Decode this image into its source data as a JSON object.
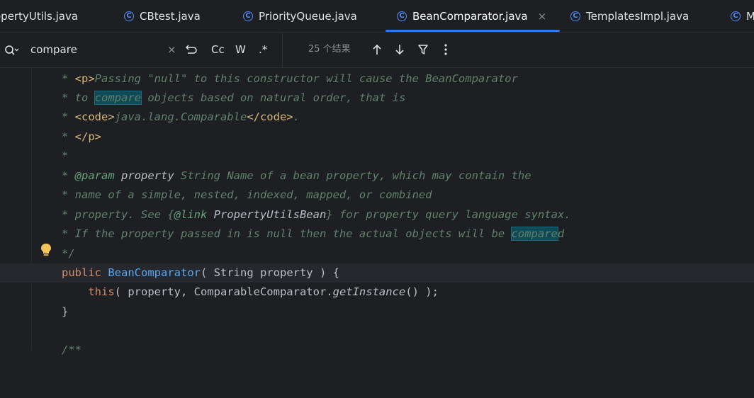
{
  "tabs": [
    {
      "label": "opertyUtils.java",
      "active": false,
      "icon": "class-icon"
    },
    {
      "label": "CBtest.java",
      "active": false,
      "icon": "class-icon"
    },
    {
      "label": "PriorityQueue.java",
      "active": false,
      "icon": "class-icon"
    },
    {
      "label": "BeanComparator.java",
      "active": true,
      "icon": "class-icon"
    },
    {
      "label": "TemplatesImpl.java",
      "active": false,
      "icon": "class-icon"
    },
    {
      "label": "M",
      "active": false,
      "icon": "class-icon"
    }
  ],
  "tab_close_symbol": "×",
  "search": {
    "value": "compare",
    "clear_symbol": "×",
    "match_case_label": "Cc",
    "words_label": "W",
    "regex_label": ".*",
    "results": "25 个结果"
  },
  "colors": {
    "accent": "#3574f0",
    "background": "#1e1f22",
    "doc_comment": "#5f826b",
    "keyword": "#cf8e6d",
    "function": "#56a8f5",
    "match_highlight": "#114957"
  },
  "code": {
    "l1_star": "* ",
    "l1_tag_open": "<p>",
    "l1_text": "Passing \"null\" to this constructor will cause the BeanComparator",
    "l2_a": "* to ",
    "l2_match": "compare",
    "l2_b": " objects based on natural order, that is",
    "l3_star": "* ",
    "l3_code_open": "<code>",
    "l3_text": "java.lang.Comparable",
    "l3_code_close": "</code>",
    "l3_end": ".",
    "l4_star": "* ",
    "l4_tag_close": "</p>",
    "l5": "*",
    "l6_star": "* ",
    "l6_param": "@param",
    "l6_name": " property",
    "l6_text": " String Name of a bean property, which may contain the",
    "l7": "* name of a simple, nested, indexed, mapped, or combined",
    "l8_a": "* property. See {",
    "l8_link": "@link",
    "l8_ref": " PropertyUtilsBean",
    "l8_b": "} for property query language syntax.",
    "l9_a": "* If the property passed in is null then the actual objects will be ",
    "l9_match": "compare",
    "l9_b": "d",
    "l10": "*/",
    "l11_kw": "public",
    "l11_sp": " ",
    "l11_fn": "BeanComparator",
    "l11_rest": "( String property ) {",
    "l12_indent": "    ",
    "l12_kw": "this",
    "l12_a": "( property, ComparableComparator.",
    "l12_call": "getInstance",
    "l12_b": "() );",
    "l13": "}",
    "l14": "",
    "l15": "/**"
  }
}
